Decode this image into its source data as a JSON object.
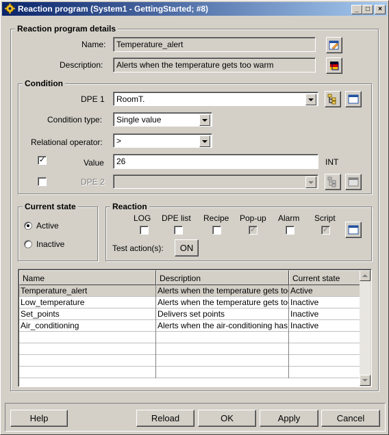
{
  "window": {
    "title": "Reaction program (System1 - GettingStarted; #8)",
    "controls": {
      "minimize": "_",
      "maximize": "□",
      "close": "×"
    }
  },
  "details": {
    "group_title": "Reaction program details",
    "name_label": "Name:",
    "name_value": "Temperature_alert",
    "description_label": "Description:",
    "description_value": "Alerts when the temperature gets too warm"
  },
  "condition": {
    "group_title": "Condition",
    "dpe1_label": "DPE 1",
    "dpe1_value": "RoomT.",
    "condition_type_label": "Condition type:",
    "condition_type_value": "Single value",
    "relational_operator_label": "Relational operator:",
    "relational_operator_value": ">",
    "value_label": "Value",
    "value_value": "26",
    "value_type": "INT",
    "value_checked": true,
    "dpe2_label": "DPE 2",
    "dpe2_checked": false
  },
  "current_state": {
    "group_title": "Current state",
    "active_label": "Active",
    "inactive_label": "Inactive",
    "selected": "Active"
  },
  "reaction": {
    "group_title": "Reaction",
    "options": [
      {
        "label": "LOG",
        "checked": false,
        "enabled": true
      },
      {
        "label": "DPE list",
        "checked": false,
        "enabled": true
      },
      {
        "label": "Recipe",
        "checked": false,
        "enabled": true
      },
      {
        "label": "Pop-up",
        "checked": true,
        "enabled": false
      },
      {
        "label": "Alarm",
        "checked": false,
        "enabled": true
      },
      {
        "label": "Script",
        "checked": true,
        "enabled": false
      }
    ],
    "test_label": "Test action(s):",
    "test_button": "ON"
  },
  "table": {
    "columns": [
      "Name",
      "Description",
      "Current state"
    ],
    "rows": [
      [
        "Temperature_alert",
        "Alerts when the temperature gets too warm",
        "Active"
      ],
      [
        "Low_temperature",
        "Alerts when the temperature gets too cold",
        "Inactive"
      ],
      [
        "Set_points",
        "Delivers set points",
        "Inactive"
      ],
      [
        "Air_conditioning",
        "Alerts when the air-conditioning has a fault",
        "Inactive"
      ]
    ],
    "selected_row": 0
  },
  "buttons": {
    "help": "Help",
    "reload": "Reload",
    "ok": "OK",
    "apply": "Apply",
    "cancel": "Cancel"
  }
}
